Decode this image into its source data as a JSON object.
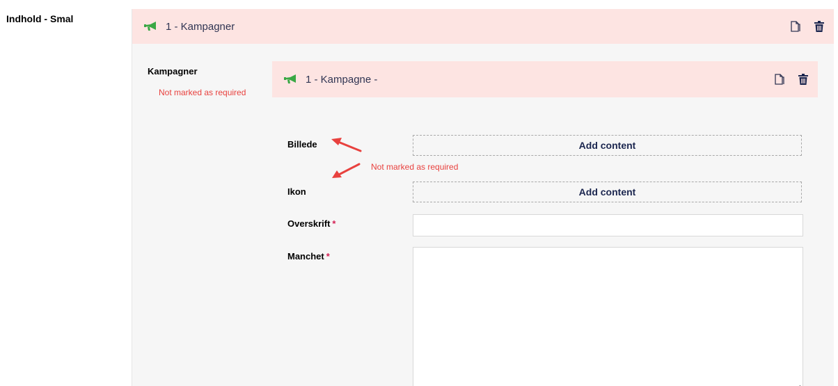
{
  "outer_property_label": "Indhold - Smal",
  "outer_block": {
    "title": "1 - Kampagner",
    "icon": "megaphone-icon",
    "actions": [
      "copy-icon",
      "trash-icon"
    ]
  },
  "kampagner_property": {
    "label": "Kampagner",
    "annotation": "Not marked as required"
  },
  "inner_block": {
    "title": "1 - Kampagne -",
    "icon": "megaphone-icon",
    "actions": [
      "copy-icon",
      "trash-icon"
    ],
    "fields": {
      "billede": {
        "label": "Billede",
        "button": "Add content"
      },
      "ikon": {
        "label": "Ikon",
        "button": "Add content"
      },
      "overskrift": {
        "label": "Overskrift",
        "required_mark": "*",
        "value": ""
      },
      "manchet": {
        "label": "Manchet",
        "required_mark": "*",
        "value": ""
      }
    },
    "annotation": "Not marked as required"
  },
  "colors": {
    "header_bg": "#fde4e2",
    "panel_bg": "#f6f6f6",
    "megaphone": "#3aa845",
    "annotation": "#e8413e",
    "required": "#d42054",
    "text_dark": "#1b264f"
  }
}
